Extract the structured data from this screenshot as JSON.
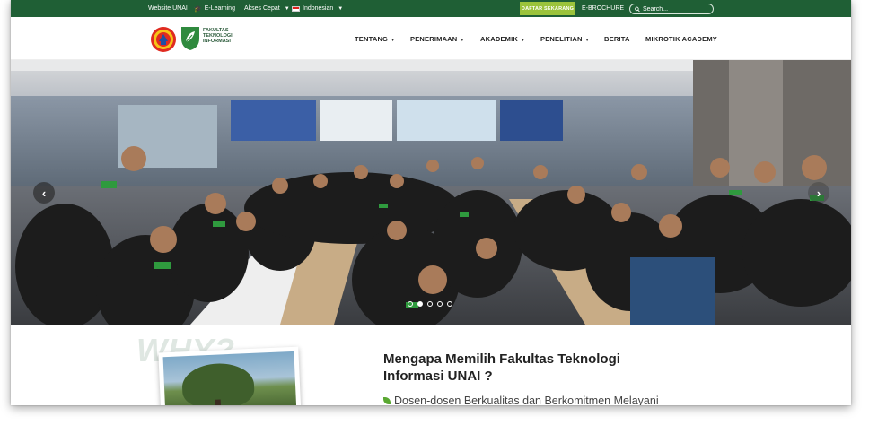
{
  "topbar": {
    "website_link": "Website UNAI",
    "elearning_link": "E-Learning",
    "akses_cepat": "Akses Cepat",
    "language": "Indonesian",
    "daftar_button": "DAFTAR SEKARANG",
    "ebrochure_link": "E-BROCHURE",
    "search_placeholder": "Search..."
  },
  "header": {
    "logo_text_line1": "FAKULTAS",
    "logo_text_line2": "TEKNOLOGI",
    "logo_text_line3": "INFORMASI",
    "nav": [
      {
        "label": "TENTANG"
      },
      {
        "label": "PENERIMAAN"
      },
      {
        "label": "AKADEMIK"
      },
      {
        "label": "PENELITIAN"
      },
      {
        "label": "BERITA"
      },
      {
        "label": "MIKROTIK ACADEMY"
      }
    ]
  },
  "hero": {
    "slide_count": 5,
    "active_slide": 1
  },
  "why": {
    "background_word": "WHY?",
    "title": "Mengapa Memilih Fakultas Teknologi Informasi UNAI ?",
    "point_1": "Dosen-dosen Berkualitas dan Berkomitmen Melayani"
  },
  "colors": {
    "topbar": "#1f5f35",
    "accent": "#9bc33b"
  },
  "icons": {
    "elearning": "graduation-cap-icon",
    "search": "search-icon",
    "language": "indonesia-flag-icon"
  }
}
